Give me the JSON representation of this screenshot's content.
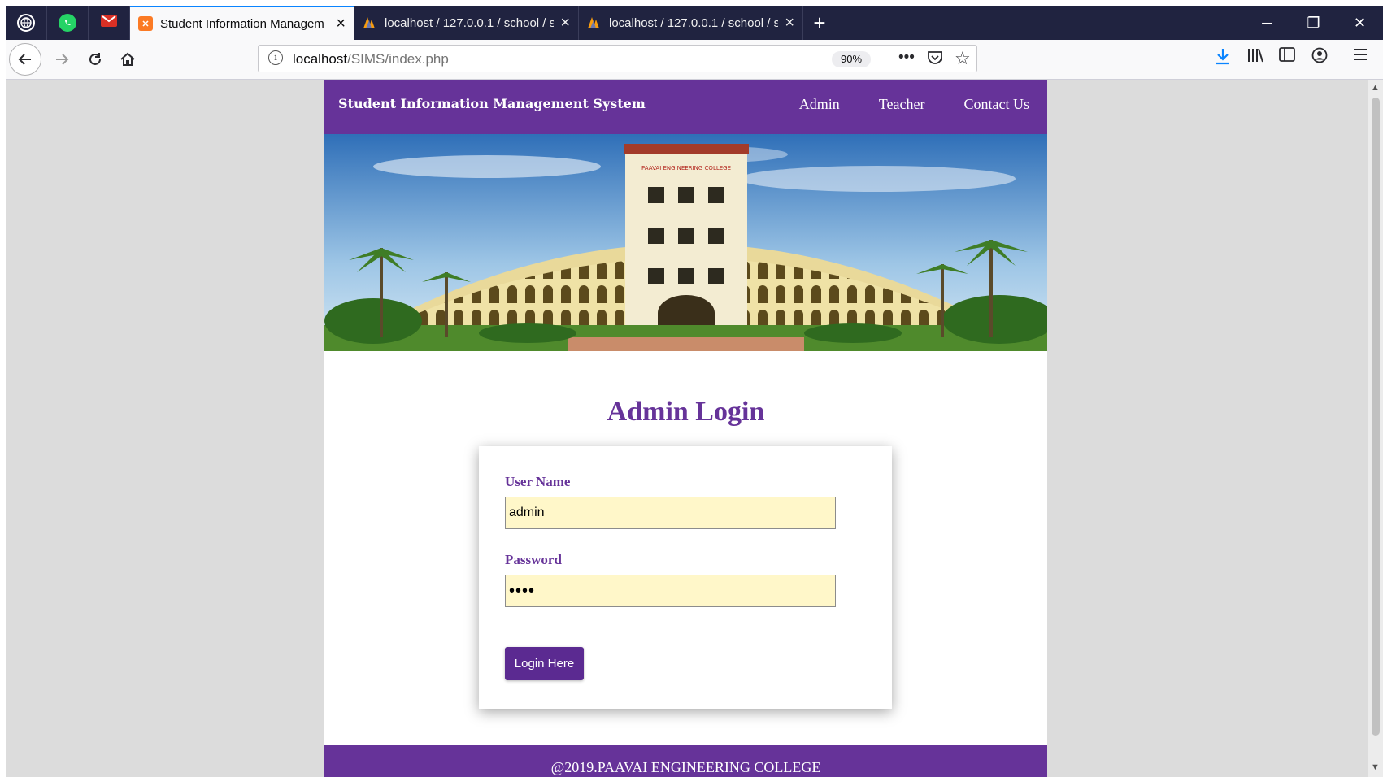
{
  "browser": {
    "tabs": [
      {
        "title": "Student Information Managem",
        "active": true
      },
      {
        "title": "localhost / 127.0.0.1 / school / s",
        "active": false
      },
      {
        "title": "localhost / 127.0.0.1 / school / s",
        "active": false
      }
    ],
    "url_host": "localhost",
    "url_path": "/SIMS/index.php",
    "zoom": "90%"
  },
  "site": {
    "brand": "Student Information Management System",
    "nav": {
      "admin": "Admin",
      "teacher": "Teacher",
      "contact": "Contact Us"
    },
    "hero_sign": "PAAVAI ENGINEERING COLLEGE",
    "login": {
      "title": "Admin Login",
      "username_label": "User Name",
      "username_value": "admin",
      "password_label": "Password",
      "password_value": "••••",
      "button": "Login Here"
    },
    "footer": "@2019.PAAVAI ENGINEERING COLLEGE"
  },
  "colors": {
    "brand": "#663399",
    "input_bg": "#fff7c9",
    "button": "#5b2a91"
  }
}
